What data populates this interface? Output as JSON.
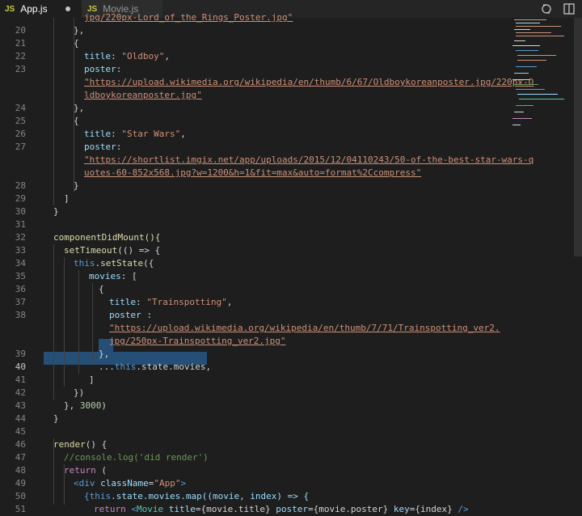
{
  "tabs": [
    {
      "icon": "JS",
      "label": "App.js",
      "modified": true,
      "active": true
    },
    {
      "icon": "JS",
      "label": "Movie.js",
      "modified": false,
      "active": false
    }
  ],
  "line_numbers": [
    "20",
    "21",
    "22",
    "23",
    "24",
    "25",
    "26",
    "27",
    "28",
    "29",
    "30",
    "31",
    "32",
    "33",
    "34",
    "35",
    "36",
    "37",
    "38",
    "39",
    "40",
    "41",
    "42",
    "43",
    "44",
    "45",
    "46",
    "47",
    "48",
    "49",
    "50",
    "51"
  ],
  "current_line": "40",
  "code": {
    "l20": "},",
    "l21": "{",
    "l22_key": "title",
    "l22_val": "\"Oldboy\"",
    "l23_key": "poster",
    "l23_url_a": "\"https://upload.wikimedia.org/wikipedia/en/thumb/6/67/Oldboykoreanposter.jpg/220px-O",
    "l23_url_b": "ldboykoreanposter.jpg\"",
    "l24": "},",
    "l25": "{",
    "l26_key": "title",
    "l26_val": "\"Star Wars\"",
    "l27_key": "poster",
    "l27_url_a": "\"https://shortlist.imgix.net/app/uploads/2015/12/04110243/50-of-the-best-star-wars-q",
    "l27_url_b": "uotes-60-852x568.jpg?w=1200&h=1&fit=max&auto=format%2Ccompress\"",
    "l28": "}",
    "l29": "]",
    "l30": "}",
    "l32": "componentDidMount(){",
    "l33_fn": "setTimeout",
    "l33_rest": "(() => {",
    "l34_this": "this",
    "l34_fn": ".setState",
    "l34_rest": "({",
    "l35_key": "movies",
    "l35_rest": ": [",
    "l36": "{",
    "l37_key": "title",
    "l37_val": "\"Trainspotting\"",
    "l38_key": "poster",
    "l38_url_a": "\"https://upload.wikimedia.org/wikipedia/en/thumb/7/71/Trainspotting_ver2.",
    "l38_url_b": "jpg/250px-Trainspotting_ver2.jpg\"",
    "l39": "},",
    "l40_spread": "...",
    "l40_this": "this",
    "l40_rest": ".state.movies,",
    "l41": "]",
    "l42": "})",
    "l43_a": "}, ",
    "l43_num": "3000",
    "l43_b": ")",
    "l44": "}",
    "l46_fn": "render",
    "l46_rest": "() {",
    "l47": "//console.log('did render')",
    "l48_kw": "return",
    "l48_rest": " (",
    "l49_open": "<",
    "l49_tag": "div",
    "l49_attr": " className",
    "l49_eq": "=",
    "l49_val": "\"App\"",
    "l49_close": ">",
    "l50_this": "{this",
    "l50_rest": ".state.movies.map((movie, index) => {",
    "l51_kw": "return",
    "l51_lt": " <",
    "l51_tag": "Movie",
    "l51_a1": " title",
    "l51_v1": "={movie.title}",
    "l51_a2": " poster",
    "l51_v2": "={movie.poster}",
    "l51_a3": " key",
    "l51_v3": "={index}",
    "l51_end": " />",
    "l19_partial": "jpg/220px-Lord_of_the_Rings_Poster.jpg\""
  },
  "colors": {
    "background": "#1e1e1e",
    "selection": "#264f78",
    "keyword": "#569cd6",
    "string": "#ce9178",
    "property": "#9cdcfe",
    "function": "#dcdcaa",
    "number": "#b5cea8",
    "comment": "#6a9955"
  },
  "icons": {
    "split": "split-editor-icon",
    "compare": "open-changes-icon"
  }
}
